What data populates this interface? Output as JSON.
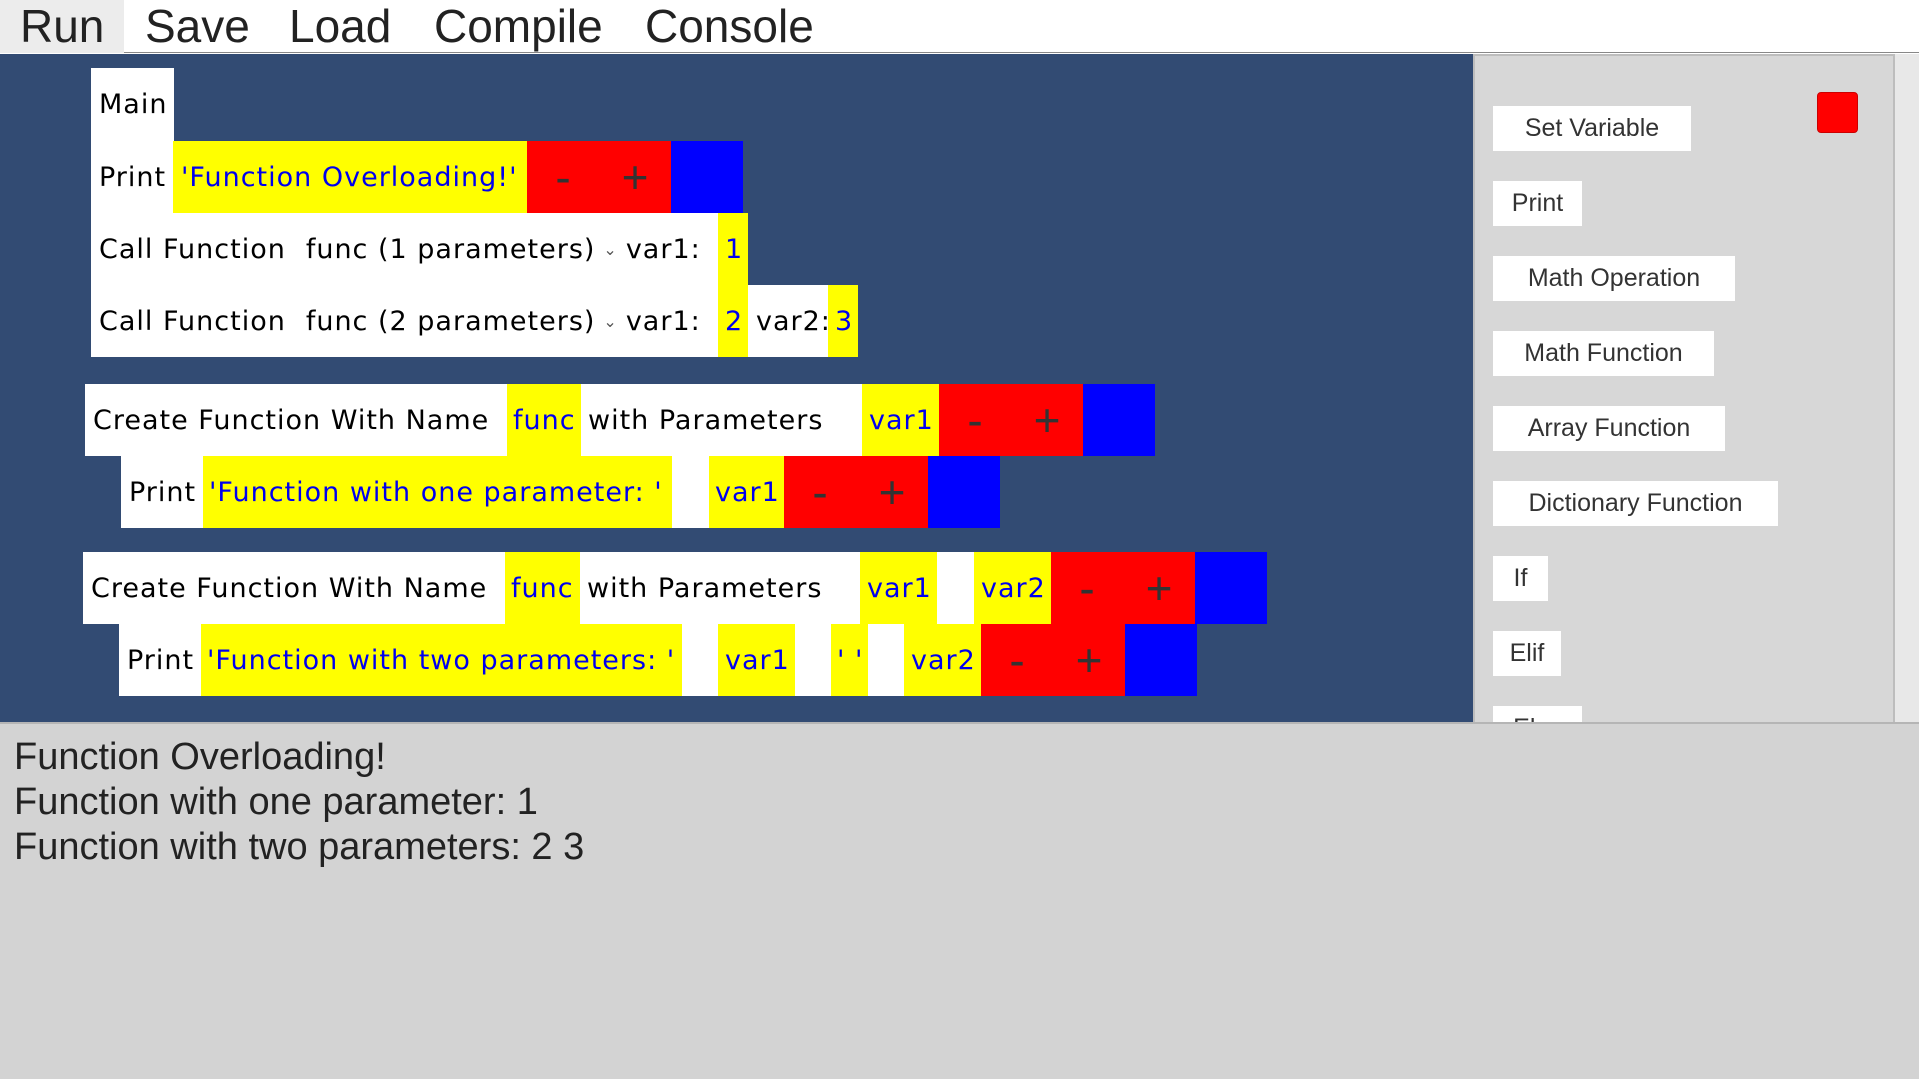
{
  "menu": {
    "run": "Run",
    "save": "Save",
    "load": "Load",
    "compile": "Compile",
    "console": "Console"
  },
  "main_block": {
    "title": "Main",
    "print_label": "Print",
    "print_value": "'Function Overloading!'",
    "call1": {
      "label": "Call Function",
      "func": "func (1 parameters)",
      "param1_name": "var1:",
      "param1_value": "1"
    },
    "call2": {
      "label": "Call Function",
      "func": "func (2 parameters)",
      "param1_name": "var1:",
      "param1_value": "2",
      "param2_name": "var2:",
      "param2_value": "3"
    }
  },
  "func_block_1": {
    "label": "Create Function With Name",
    "name": "func",
    "with_params": "with Parameters",
    "param1": "var1",
    "print_label": "Print",
    "print_string": "'Function with one parameter: '",
    "print_var1": "var1"
  },
  "func_block_2": {
    "label": "Create Function With Name",
    "name": "func",
    "with_params": "with Parameters",
    "param1": "var1",
    "param2": "var2",
    "print_label": "Print",
    "print_string": "'Function with two parameters: '",
    "print_var1": "var1",
    "print_space": "' '",
    "print_var2": "var2"
  },
  "controls": {
    "minus": "-",
    "plus": "+"
  },
  "palette": {
    "items": [
      "Set Variable",
      "Print",
      "Math Operation",
      "Math Function",
      "Array Function",
      "Dictionary Function",
      "If",
      "Elif",
      "Else"
    ]
  },
  "console_output": [
    "Function Overloading!",
    "Function with one parameter: 1",
    "Function with two parameters: 2 3"
  ],
  "colors": {
    "canvas": "#324b73",
    "value_highlight": "#ffff00",
    "value_text": "#0000ee",
    "remove_add": "#ff0000",
    "block_handle": "#0000ff",
    "console_bg": "#d3d3d3",
    "palette_bg": "#d7d7d7"
  }
}
